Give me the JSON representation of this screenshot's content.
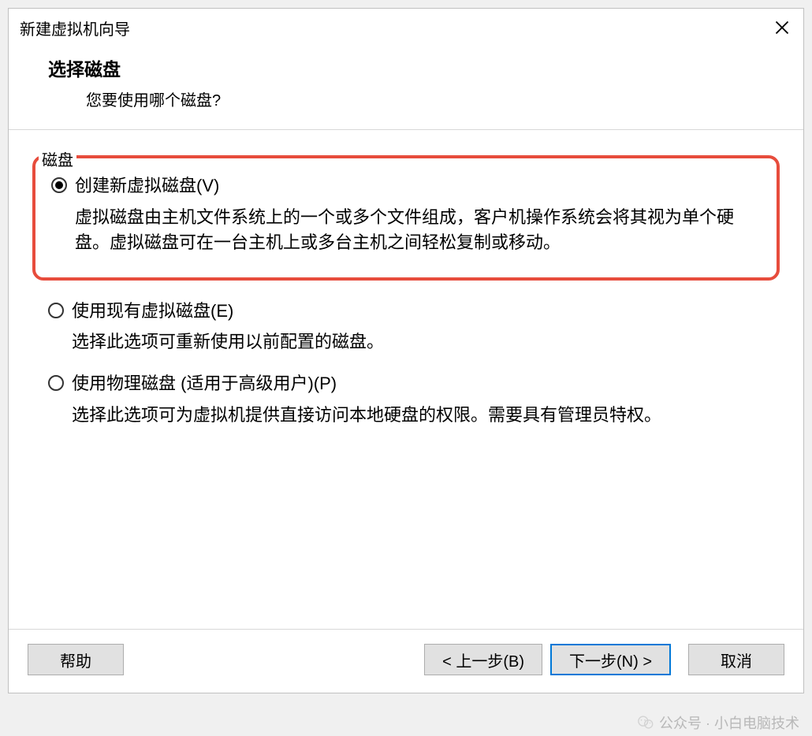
{
  "dialog": {
    "title": "新建虚拟机向导"
  },
  "header": {
    "title": "选择磁盘",
    "subtitle": "您要使用哪个磁盘?"
  },
  "groupbox": {
    "label": "磁盘"
  },
  "options": {
    "create_new": {
      "label": "创建新虚拟磁盘(V)",
      "desc": "虚拟磁盘由主机文件系统上的一个或多个文件组成，客户机操作系统会将其视为单个硬盘。虚拟磁盘可在一台主机上或多台主机之间轻松复制或移动。",
      "selected": true
    },
    "use_existing": {
      "label": "使用现有虚拟磁盘(E)",
      "desc": "选择此选项可重新使用以前配置的磁盘。",
      "selected": false
    },
    "use_physical": {
      "label": "使用物理磁盘 (适用于高级用户)(P)",
      "desc": "选择此选项可为虚拟机提供直接访问本地硬盘的权限。需要具有管理员特权。",
      "selected": false
    }
  },
  "buttons": {
    "help": "帮助",
    "back": "< 上一步(B)",
    "next": "下一步(N) >",
    "cancel": "取消"
  },
  "watermark": {
    "text": "公众号 · 小白电脑技术"
  }
}
